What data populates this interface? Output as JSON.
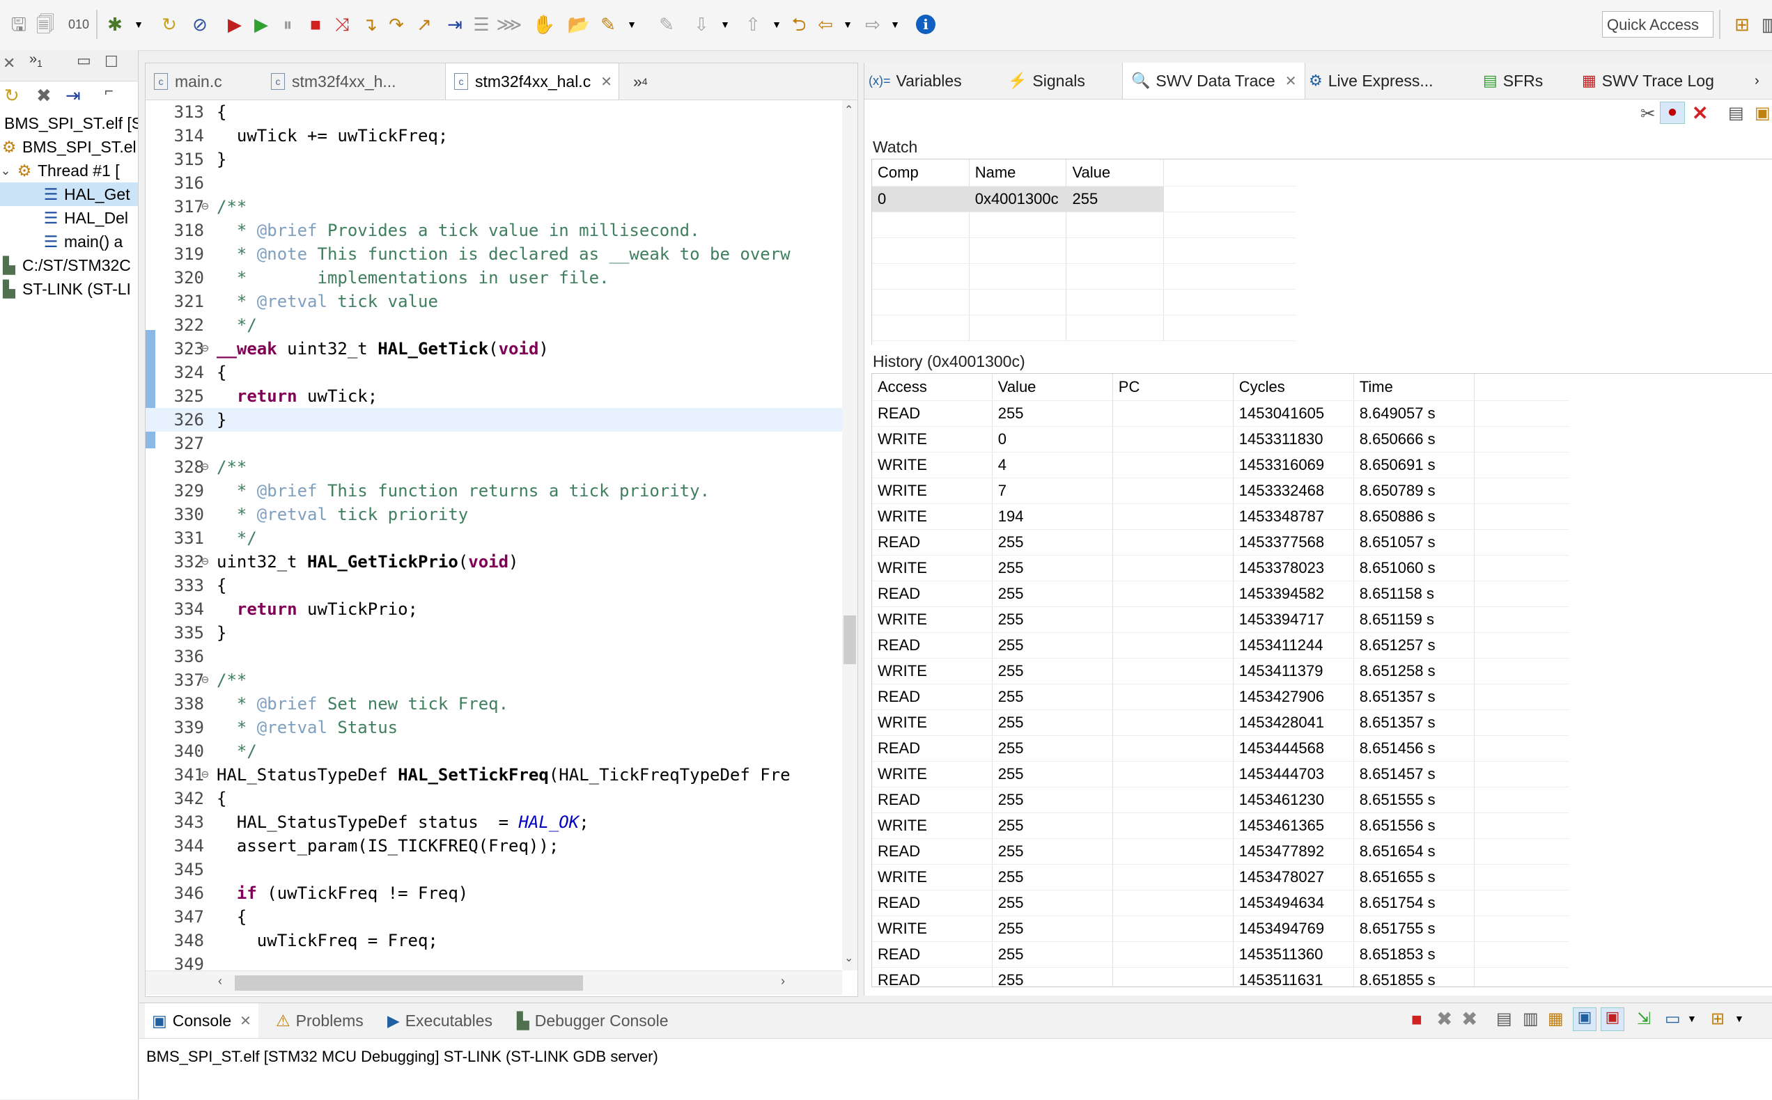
{
  "toolbar": {
    "quick_access": "Quick Access",
    "info_label": "i"
  },
  "debug_view": {
    "tab_badge": "1",
    "items": [
      {
        "label": "BMS_SPI_ST.elf [S"
      },
      {
        "label": "BMS_SPI_ST.el"
      },
      {
        "label": "Thread #1 ["
      },
      {
        "label": "HAL_Get"
      },
      {
        "label": "HAL_Del"
      },
      {
        "label": "main() a"
      },
      {
        "label": "C:/ST/STM32C"
      },
      {
        "label": "ST-LINK (ST-LI"
      }
    ]
  },
  "editor": {
    "tabs": [
      {
        "label": "main.c"
      },
      {
        "label": "stm32f4xx_h..."
      },
      {
        "label": "stm32f4xx_hal.c"
      }
    ],
    "overflow_count": "4",
    "lines": [
      {
        "n": "313",
        "t": "{"
      },
      {
        "n": "314",
        "t": "  uwTick += uwTickFreq;"
      },
      {
        "n": "315",
        "t": "}"
      },
      {
        "n": "316",
        "t": ""
      },
      {
        "n": "317",
        "t": "/**"
      },
      {
        "n": "318",
        "t": "  * @brief Provides a tick value in millisecond."
      },
      {
        "n": "319",
        "t": "  * @note This function is declared as __weak to be overw"
      },
      {
        "n": "320",
        "t": "  *       implementations in user file."
      },
      {
        "n": "321",
        "t": "  * @retval tick value"
      },
      {
        "n": "322",
        "t": "  */"
      },
      {
        "n": "323",
        "t": "__weak uint32_t HAL_GetTick(void)"
      },
      {
        "n": "324",
        "t": "{"
      },
      {
        "n": "325",
        "t": "  return uwTick;"
      },
      {
        "n": "326",
        "t": "}"
      },
      {
        "n": "327",
        "t": ""
      },
      {
        "n": "328",
        "t": "/**"
      },
      {
        "n": "329",
        "t": "  * @brief This function returns a tick priority."
      },
      {
        "n": "330",
        "t": "  * @retval tick priority"
      },
      {
        "n": "331",
        "t": "  */"
      },
      {
        "n": "332",
        "t": "uint32_t HAL_GetTickPrio(void)"
      },
      {
        "n": "333",
        "t": "{"
      },
      {
        "n": "334",
        "t": "  return uwTickPrio;"
      },
      {
        "n": "335",
        "t": "}"
      },
      {
        "n": "336",
        "t": ""
      },
      {
        "n": "337",
        "t": "/**"
      },
      {
        "n": "338",
        "t": "  * @brief Set new tick Freq."
      },
      {
        "n": "339",
        "t": "  * @retval Status"
      },
      {
        "n": "340",
        "t": "  */"
      },
      {
        "n": "341",
        "t": "HAL_StatusTypeDef HAL_SetTickFreq(HAL_TickFreqTypeDef Fre"
      },
      {
        "n": "342",
        "t": "{"
      },
      {
        "n": "343",
        "t": "  HAL_StatusTypeDef status  = HAL_OK;"
      },
      {
        "n": "344",
        "t": "  assert_param(IS_TICKFREQ(Freq));"
      },
      {
        "n": "345",
        "t": ""
      },
      {
        "n": "346",
        "t": "  if (uwTickFreq != Freq)"
      },
      {
        "n": "347",
        "t": "  {"
      },
      {
        "n": "348",
        "t": "    uwTickFreq = Freq;"
      },
      {
        "n": "349",
        "t": ""
      }
    ]
  },
  "right_view": {
    "tabs": [
      {
        "label": "Variables",
        "icon": "(x)="
      },
      {
        "label": "Signals"
      },
      {
        "label": "SWV Data Trace"
      },
      {
        "label": "Live Express..."
      },
      {
        "label": "SFRs"
      },
      {
        "label": "SWV Trace Log"
      }
    ],
    "watch": {
      "title": "Watch",
      "columns": [
        "Comp",
        "Name",
        "Value"
      ],
      "rows": [
        [
          "0",
          "0x4001300c",
          "255"
        ]
      ]
    },
    "history": {
      "title": "History (0x4001300c)",
      "columns": [
        "Access",
        "Value",
        "PC",
        "Cycles",
        "Time"
      ],
      "rows": [
        [
          "READ",
          "255",
          "",
          "1453041605",
          "8.649057 s"
        ],
        [
          "WRITE",
          "0",
          "",
          "1453311830",
          "8.650666 s"
        ],
        [
          "WRITE",
          "4",
          "",
          "1453316069",
          "8.650691 s"
        ],
        [
          "WRITE",
          "7",
          "",
          "1453332468",
          "8.650789 s"
        ],
        [
          "WRITE",
          "194",
          "",
          "1453348787",
          "8.650886 s"
        ],
        [
          "READ",
          "255",
          "",
          "1453377568",
          "8.651057 s"
        ],
        [
          "WRITE",
          "255",
          "",
          "1453378023",
          "8.651060 s"
        ],
        [
          "READ",
          "255",
          "",
          "1453394582",
          "8.651158 s"
        ],
        [
          "WRITE",
          "255",
          "",
          "1453394717",
          "8.651159 s"
        ],
        [
          "READ",
          "255",
          "",
          "1453411244",
          "8.651257 s"
        ],
        [
          "WRITE",
          "255",
          "",
          "1453411379",
          "8.651258 s"
        ],
        [
          "READ",
          "255",
          "",
          "1453427906",
          "8.651357 s"
        ],
        [
          "WRITE",
          "255",
          "",
          "1453428041",
          "8.651357 s"
        ],
        [
          "READ",
          "255",
          "",
          "1453444568",
          "8.651456 s"
        ],
        [
          "WRITE",
          "255",
          "",
          "1453444703",
          "8.651457 s"
        ],
        [
          "READ",
          "255",
          "",
          "1453461230",
          "8.651555 s"
        ],
        [
          "WRITE",
          "255",
          "",
          "1453461365",
          "8.651556 s"
        ],
        [
          "READ",
          "255",
          "",
          "1453477892",
          "8.651654 s"
        ],
        [
          "WRITE",
          "255",
          "",
          "1453478027",
          "8.651655 s"
        ],
        [
          "READ",
          "255",
          "",
          "1453494634",
          "8.651754 s"
        ],
        [
          "WRITE",
          "255",
          "",
          "1453494769",
          "8.651755 s"
        ],
        [
          "READ",
          "255",
          "",
          "1453511360",
          "8.651853 s"
        ],
        [
          "READ",
          "255",
          "",
          "1453511631",
          "8.651855 s"
        ]
      ]
    }
  },
  "console": {
    "tabs": [
      {
        "label": "Console"
      },
      {
        "label": "Problems"
      },
      {
        "label": "Executables"
      },
      {
        "label": "Debugger Console"
      }
    ],
    "text": "BMS_SPI_ST.elf [STM32 MCU Debugging] ST-LINK (ST-LINK GDB server)"
  },
  "colors": {
    "keyword": "#7f0055",
    "comment": "#3f7f5f",
    "javadoc_tag": "#7f9fbf",
    "selected_row": "#e0e0e0",
    "current_line": "#e8f2fe"
  }
}
